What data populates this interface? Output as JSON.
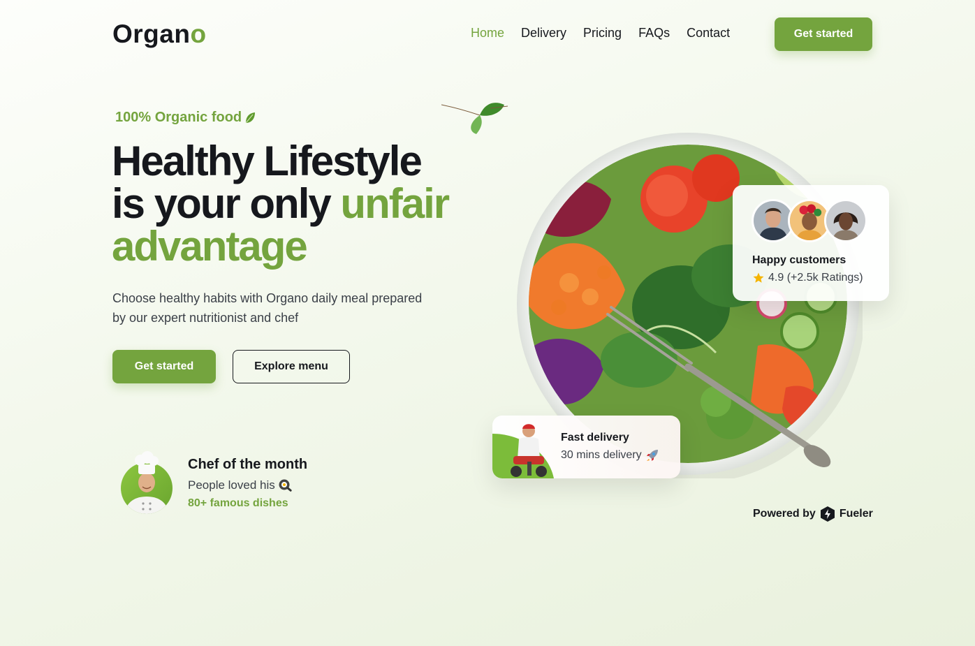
{
  "header": {
    "logo_main": "Organ",
    "logo_accent": "o",
    "nav": [
      {
        "label": "Home",
        "active": true
      },
      {
        "label": "Delivery",
        "active": false
      },
      {
        "label": "Pricing",
        "active": false
      },
      {
        "label": "FAQs",
        "active": false
      },
      {
        "label": "Contact",
        "active": false
      }
    ],
    "cta_label": "Get started"
  },
  "hero": {
    "eyebrow": "100% Organic food",
    "eyebrow_icon": "leaf-icon",
    "headline_line1": "Healthy Lifestyle",
    "headline_line2": "is your only ",
    "headline_accent_1": "unfair",
    "headline_accent_2": "advantage",
    "subtext": "Choose healthy habits with Organo daily meal prepared by our expert nutritionist and chef",
    "primary_cta": "Get started",
    "secondary_cta": "Explore menu"
  },
  "chef": {
    "title": "Chef of the month",
    "subtitle": "People loved his",
    "subtitle_icon": "frying-pan-icon",
    "dishes": "80+ famous dishes"
  },
  "customers_card": {
    "title": "Happy customers",
    "rating": "4.9 (+2.5k Ratings)",
    "rating_icon": "star-icon"
  },
  "delivery_card": {
    "title": "Fast delivery",
    "subtitle": "30 mins delivery",
    "subtitle_icon": "rocket-icon"
  },
  "footer": {
    "powered_prefix": "Powered by",
    "powered_brand": "Fueler"
  },
  "colors": {
    "accent": "#74a43e",
    "text": "#16181d",
    "star": "#f5b400"
  }
}
